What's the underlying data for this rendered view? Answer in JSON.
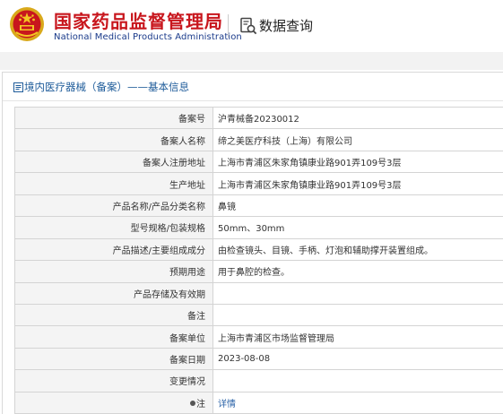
{
  "header": {
    "title_cn": "国家药品监督管理局",
    "title_en": "National Medical Products Administration",
    "query_label": "数据查询",
    "colors": {
      "brand_red": "#c8161d",
      "brand_blue": "#1a3a8a"
    }
  },
  "panel": {
    "title": "境内医疗器械（备案）——基本信息"
  },
  "rows": [
    {
      "label": "备案号",
      "value": "沪青械备20230012"
    },
    {
      "label": "备案人名称",
      "value": "缔之美医疗科技（上海）有限公司"
    },
    {
      "label": "备案人注册地址",
      "value": "上海市青浦区朱家角镇康业路901弄109号3层"
    },
    {
      "label": "生产地址",
      "value": "上海市青浦区朱家角镇康业路901弄109号3层"
    },
    {
      "label": "产品名称/产品分类名称",
      "value": "鼻镜"
    },
    {
      "label": "型号规格/包装规格",
      "value": "50mm、30mm"
    },
    {
      "label": "产品描述/主要组成成分",
      "value": "由检查镜头、目镜、手柄、灯泡和辅助撑开装置组成。"
    },
    {
      "label": "预期用途",
      "value": "用于鼻腔的检查。"
    },
    {
      "label": "产品存储及有效期",
      "value": ""
    },
    {
      "label": "备注",
      "value": ""
    },
    {
      "label": "备案单位",
      "value": "上海市青浦区市场监督管理局"
    },
    {
      "label": "备案日期",
      "value": "2023-08-08"
    },
    {
      "label": "变更情况",
      "value": ""
    },
    {
      "label": "注",
      "value": "详情",
      "is_link": true
    }
  ],
  "icons": {
    "emblem": "national-emblem-icon",
    "query": "magnifier-document-icon",
    "panel": "document-list-icon",
    "note_bullet": "bullet-dot-icon"
  }
}
